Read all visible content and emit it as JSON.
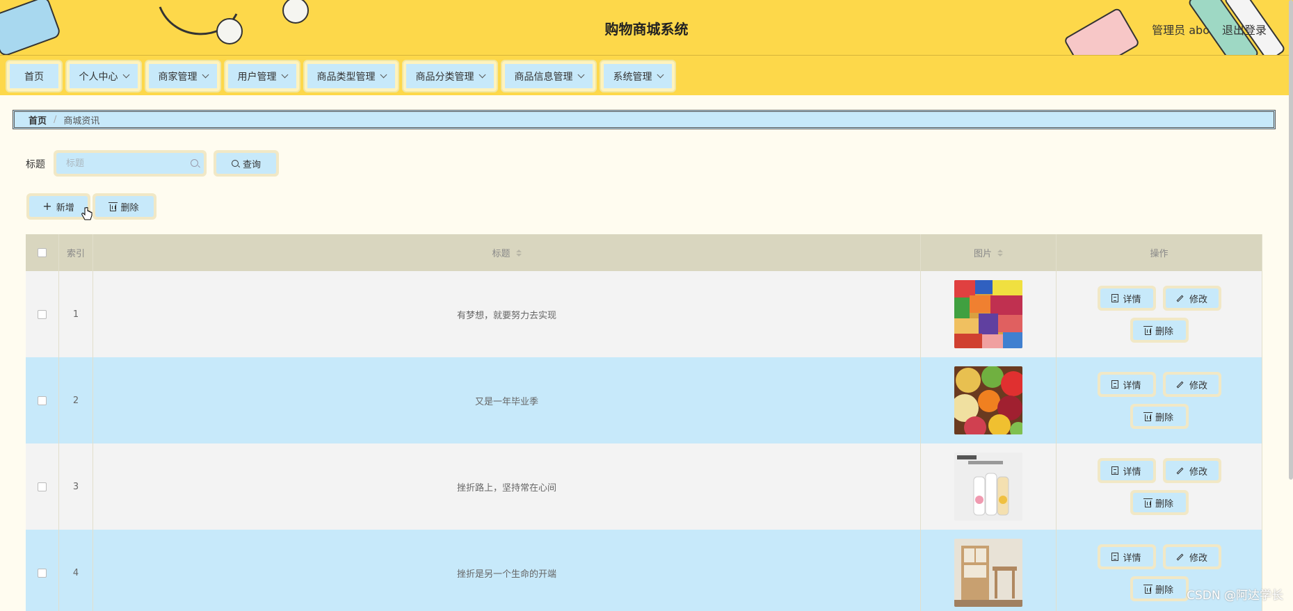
{
  "header": {
    "title": "购物商城系统",
    "user": "管理员 abo",
    "logout": "退出登录"
  },
  "nav": [
    {
      "label": "首页",
      "dropdown": false
    },
    {
      "label": "个人中心",
      "dropdown": true
    },
    {
      "label": "商家管理",
      "dropdown": true
    },
    {
      "label": "用户管理",
      "dropdown": true
    },
    {
      "label": "商品类型管理",
      "dropdown": true
    },
    {
      "label": "商品分类管理",
      "dropdown": true
    },
    {
      "label": "商品信息管理",
      "dropdown": true
    },
    {
      "label": "系统管理",
      "dropdown": true
    }
  ],
  "breadcrumb": {
    "home": "首页",
    "sep": "/",
    "current": "商城资讯"
  },
  "search": {
    "label": "标题",
    "placeholder": "标题",
    "button": "查询"
  },
  "actions": {
    "add": "新增",
    "delete": "删除"
  },
  "table": {
    "headers": {
      "index": "索引",
      "title": "标题",
      "image": "图片",
      "ops": "操作"
    },
    "rows": [
      {
        "index": "1",
        "title": "有梦想，就要努力去实现",
        "image": "snacks"
      },
      {
        "index": "2",
        "title": "又是一年毕业季",
        "image": "fruit"
      },
      {
        "index": "3",
        "title": "挫折路上，坚持常在心间",
        "image": "drinks"
      },
      {
        "index": "4",
        "title": "挫折是另一个生命的开端",
        "image": "furniture"
      }
    ],
    "ops": {
      "detail": "详情",
      "edit": "修改",
      "delete": "删除"
    }
  },
  "watermark": "CSDN @阿达学长",
  "colors": {
    "header_bg": "#fdd84a",
    "accent_blue": "#c7e9fa",
    "table_header": "#d9d6bf",
    "page_bg": "#fffcf0"
  }
}
